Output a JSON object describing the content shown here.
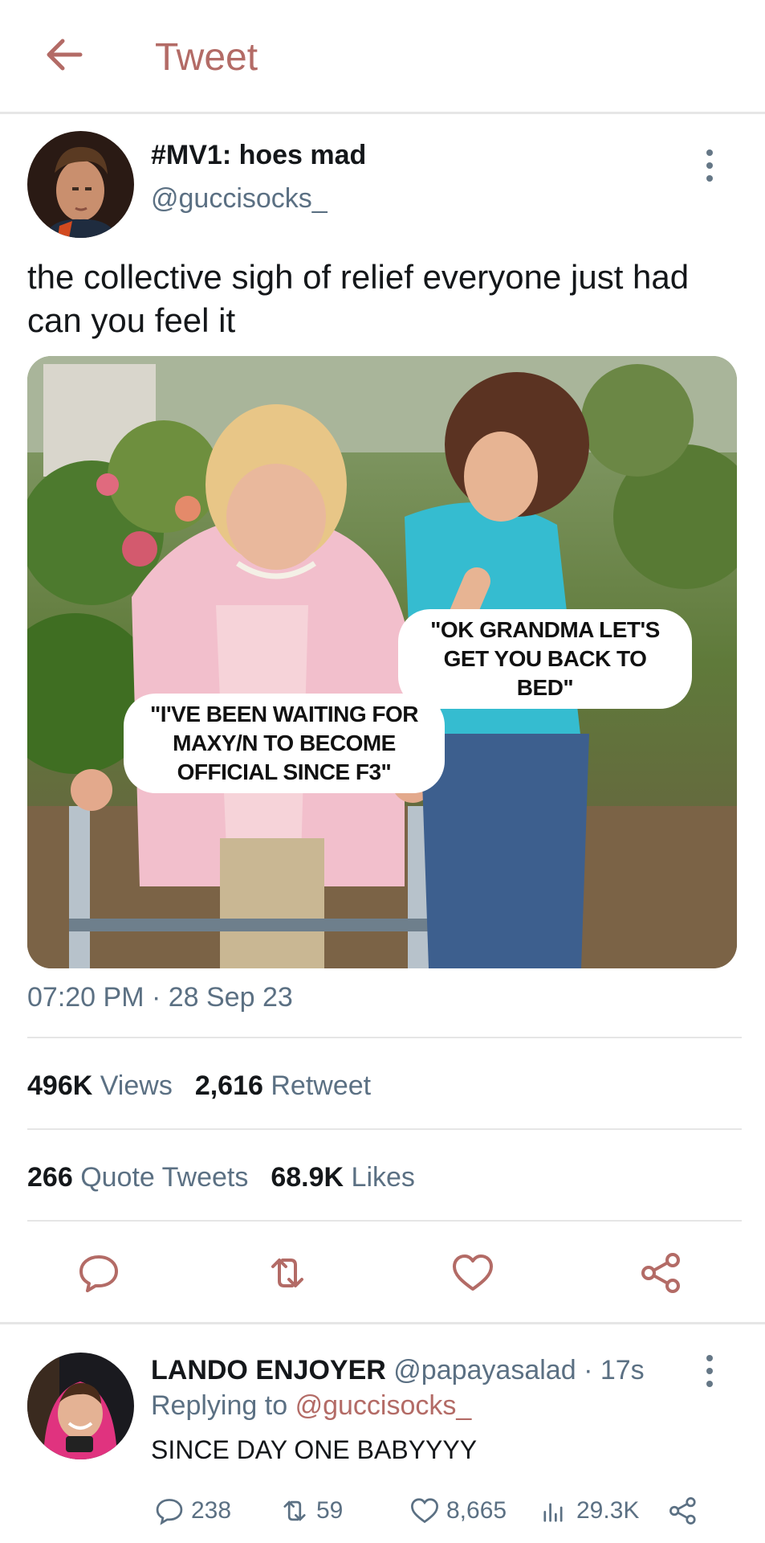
{
  "header": {
    "title": "Tweet",
    "back_icon": "arrow-left-icon"
  },
  "tweet": {
    "display_name": "#MV1: hoes mad",
    "handle": "@guccisocks_",
    "text": "the collective sigh of relief everyone just had can you feel it",
    "image": {
      "caption_grandma": "\"I'VE BEEN WAITING FOR\nMAXY/N TO BECOME\nOFFICIAL SINCE F3\"",
      "caption_girl": "\"OK GRANDMA LET'S\nGET YOU BACK TO BED\""
    },
    "timestamp": "07:20 PM · 28 Sep 23",
    "stats": {
      "views_count": "496K",
      "views_label": "Views",
      "retweet_count": "2,616",
      "retweet_label": "Retweet",
      "quote_count": "266",
      "quote_label": "Quote Tweets",
      "likes_count": "68.9K",
      "likes_label": "Likes"
    },
    "actions": [
      "reply-icon",
      "retweet-icon",
      "like-icon",
      "share-icon"
    ]
  },
  "reply": {
    "display_name": "LANDO ENJOYER",
    "handle_time": "@papayasalad · 17s",
    "replying_prefix": "Replying to",
    "replying_mention": "@guccisocks_",
    "text": "SINCE DAY ONE BABYYYY",
    "metrics": {
      "replies": "238",
      "retweets": "59",
      "likes": "8,665",
      "views": "29.3K"
    }
  },
  "colors": {
    "accent": "#b36b66",
    "secondary_text": "#5b7083",
    "divider": "#e6e6e6"
  }
}
